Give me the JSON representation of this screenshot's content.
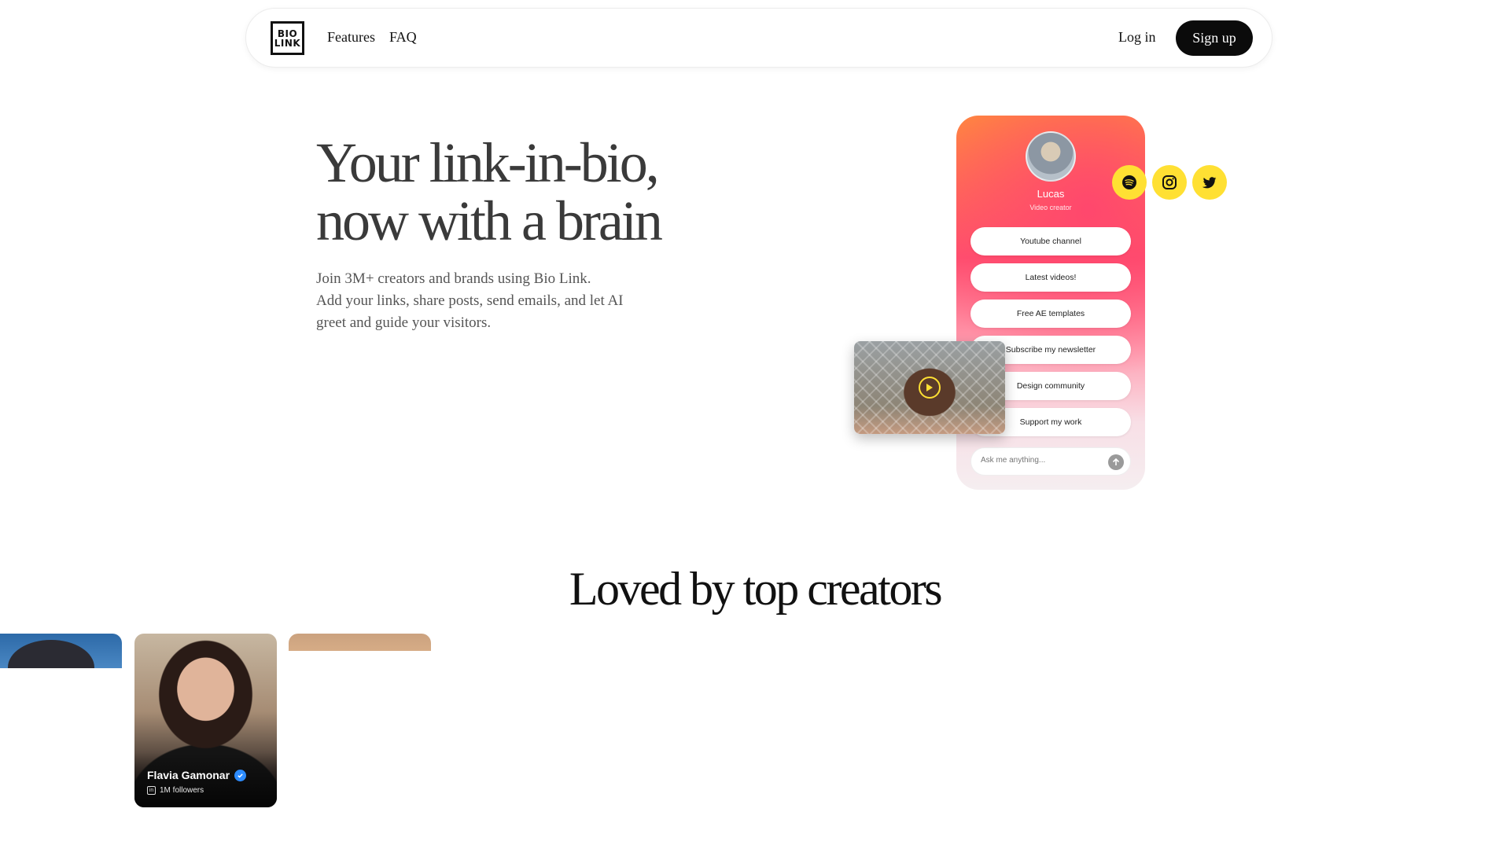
{
  "nav": {
    "logo_line1": "BIO",
    "logo_line2": "LINK",
    "features": "Features",
    "faq": "FAQ",
    "login": "Log in",
    "signup": "Sign up"
  },
  "hero": {
    "title_line1": "Your link-in-bio,",
    "title_line2": "now with a brain",
    "sub_line1": "Join 3M+ creators and brands using Bio Link.",
    "sub_line2": "Add your links, share posts, send emails, and let AI greet and guide your visitors."
  },
  "phone": {
    "name": "Lucas",
    "role": "Video creator",
    "links": [
      "Youtube channel",
      "Latest videos!",
      "Free AE templates",
      "Subscribe my newsletter",
      "Design community",
      "Support my work"
    ],
    "ask_placeholder": "Ask me anything...",
    "social_icons": [
      "spotify-icon",
      "instagram-icon",
      "twitter-icon"
    ],
    "accent": "#ffe033"
  },
  "creators": {
    "title": "Loved by top creators",
    "featured_name": "Flavia Gamonar",
    "featured_followers": "1M followers",
    "platform_icon": "linkedin-icon"
  },
  "colors": {
    "button_bg": "#0b0b0b",
    "social_yellow": "#ffe033",
    "verified_blue": "#2d8cff"
  }
}
